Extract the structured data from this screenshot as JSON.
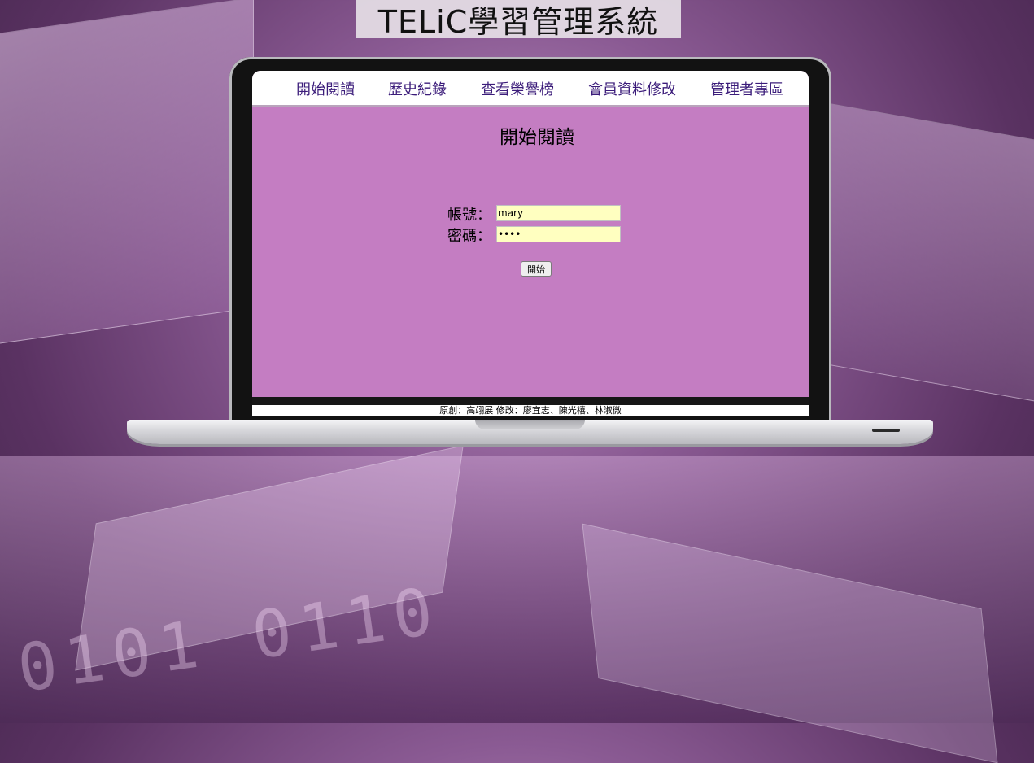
{
  "banner": {
    "title": "TELiC學習管理系統"
  },
  "nav": {
    "items": [
      {
        "label": "開始閱讀"
      },
      {
        "label": "歷史紀錄"
      },
      {
        "label": "查看榮譽榜"
      },
      {
        "label": "會員資料修改"
      },
      {
        "label": "管理者專區"
      }
    ]
  },
  "main": {
    "heading": "開始閱讀",
    "account_label": "帳號：",
    "account_value": "mary",
    "password_label": "密碼：",
    "password_value": "****",
    "start_button": "開始"
  },
  "footer": {
    "text": "原創：高翊展  修改：廖宜志、陳光禧、林淑微"
  },
  "colors": {
    "screen_bg": "#c47dc2",
    "nav_text": "#3b1c7a",
    "input_bg": "#ffffc0"
  }
}
